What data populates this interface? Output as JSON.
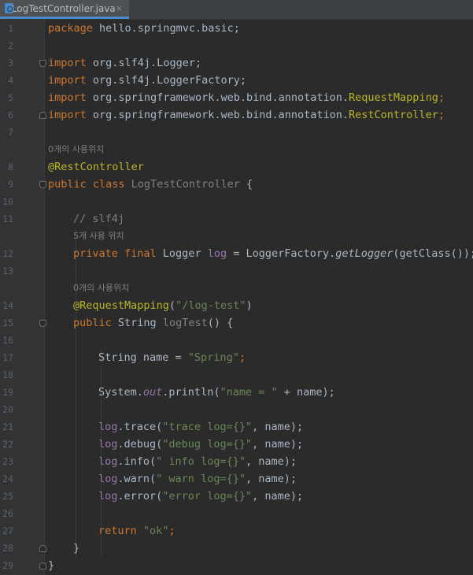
{
  "tab": {
    "label": "LogTestController.java",
    "close": "×",
    "icon": "java-class-icon"
  },
  "gutter": {
    "line_numbers": [
      "1",
      "2",
      "3",
      "4",
      "5",
      "6",
      "7",
      "8",
      "9",
      "10",
      "11",
      "12",
      "13",
      "14",
      "15",
      "16",
      "17",
      "18",
      "19",
      "20",
      "21",
      "22",
      "23",
      "24",
      "25",
      "26",
      "27",
      "28",
      "29"
    ]
  },
  "hints": {
    "class_usages": "0개의 사용위치",
    "log_usages": "5개 사용 위치",
    "method_usages": "0개의 사용위치"
  },
  "code": {
    "l1_kw": "package",
    "l1_rest": " hello.springmvc.basic;",
    "l3_kw": "import",
    "l3_rest": " org.slf4j.Logger;",
    "l4_kw": "import",
    "l4_rest": " org.slf4j.LoggerFactory;",
    "l5_kw": "import",
    "l5_pre": " org.springframework.web.bind.annotation.",
    "l5_ann": "RequestMapping",
    "l5_end": ";",
    "l6_kw": "import",
    "l6_pre": " org.springframework.web.bind.annotation.",
    "l6_ann": "RestController",
    "l6_end": ";",
    "l8_ann": "@RestController",
    "l9_kw": "public class",
    "l9_name": " LogTestController",
    "l9_end": " {",
    "l11_cmt": "// slf4j",
    "l12_kw": "private final",
    "l12_type": " Logger ",
    "l12_var": "log",
    "l12_eq": " = LoggerFactory.",
    "l12_call": "getLogger",
    "l12_end": "(getClass());",
    "l14_ann": "@RequestMapping",
    "l14_open": "(",
    "l14_str": "\"/log-test\"",
    "l14_close": ")",
    "l15_kw": "public",
    "l15_type": " String ",
    "l15_name": "logTest",
    "l15_end": "() {",
    "l17_pre": "String name = ",
    "l17_str": "\"Spring\"",
    "l17_end": ";",
    "l19_pre": "System.",
    "l19_fld": "out",
    "l19_mid": ".println(",
    "l19_str": "\"name = \"",
    "l19_end": " + name);",
    "l21_var": "log",
    "l21_call": ".trace(",
    "l21_str": "\"trace log={}\"",
    "l21_end": ", name);",
    "l22_var": "log",
    "l22_call": ".debug(",
    "l22_str": "\"debug log={}\"",
    "l22_end": ", name);",
    "l23_var": "log",
    "l23_call": ".info(",
    "l23_str": "\" info log={}\"",
    "l23_end": ", name);",
    "l24_var": "log",
    "l24_call": ".warn(",
    "l24_str": "\" warn log={}\"",
    "l24_end": ", name);",
    "l25_var": "log",
    "l25_call": ".error(",
    "l25_str": "\"error log={}\"",
    "l25_end": ", name);",
    "l27_kw": "return",
    "l27_sp": " ",
    "l27_str": "\"ok\"",
    "l27_end": ";",
    "l28": "}",
    "l29": "}"
  },
  "colors": {
    "background": "#2b2b2b",
    "gutter": "#313335",
    "keyword": "#cc7832",
    "annotation": "#bbb529",
    "string": "#6a8759",
    "comment": "#808080",
    "field": "#9876aa",
    "text": "#a9b7c6"
  }
}
